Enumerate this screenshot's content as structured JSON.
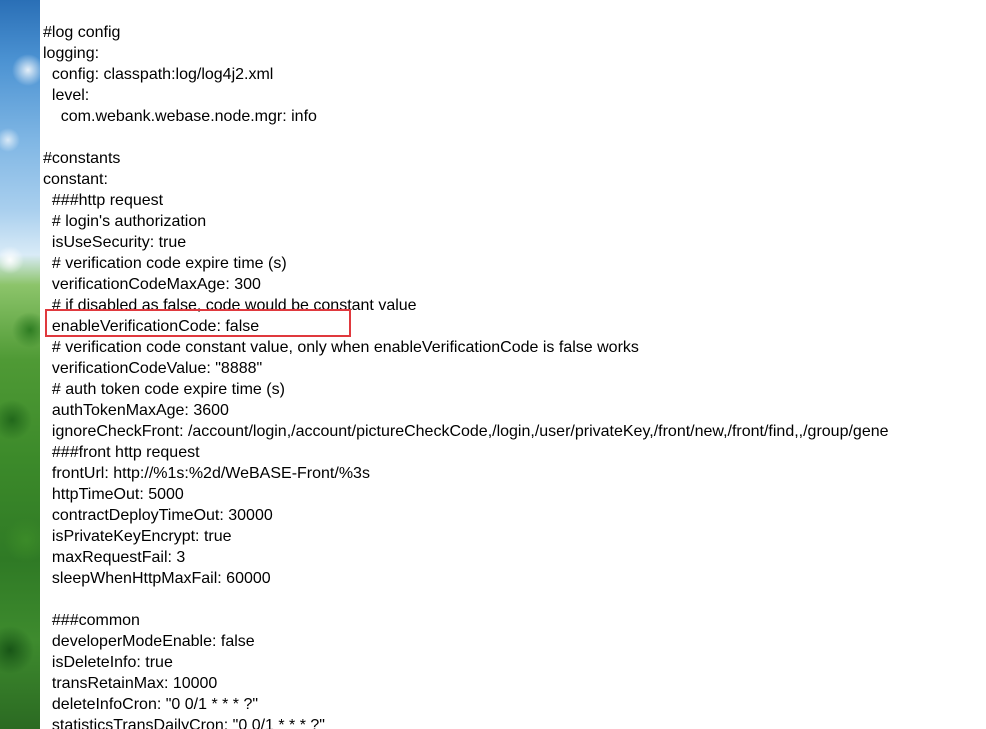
{
  "lines": [
    "#log config",
    "logging:",
    "  config: classpath:log/log4j2.xml",
    "  level:",
    "    com.webank.webase.node.mgr: info",
    "",
    "#constants",
    "constant:",
    "  ###http request",
    "  # login's authorization",
    "  isUseSecurity: true",
    "  # verification code expire time (s)",
    "  verificationCodeMaxAge: 300",
    "  # if disabled as false, code would be constant value",
    "  enableVerificationCode: false",
    "  # verification code constant value, only when enableVerificationCode is false works",
    "  verificationCodeValue: \"8888\"",
    "  # auth token code expire time (s)",
    "  authTokenMaxAge: 3600",
    "  ignoreCheckFront: /account/login,/account/pictureCheckCode,/login,/user/privateKey,/front/new,/front/find,,/group/gene",
    "  ###front http request",
    "  frontUrl: http://%1s:%2d/WeBASE-Front/%3s",
    "  httpTimeOut: 5000",
    "  contractDeployTimeOut: 30000",
    "  isPrivateKeyEncrypt: true",
    "  maxRequestFail: 3",
    "  sleepWhenHttpMaxFail: 60000",
    "",
    "  ###common",
    "  developerModeEnable: false",
    "  isDeleteInfo: true",
    "  transRetainMax: 10000",
    "  deleteInfoCron: \"0 0/1 * * * ?\"",
    "  statisticsTransDailyCron: \"0 0/1 * * * ?\""
  ],
  "highlight_color": "#e0393e",
  "wallpaper": "sky-and-trees"
}
